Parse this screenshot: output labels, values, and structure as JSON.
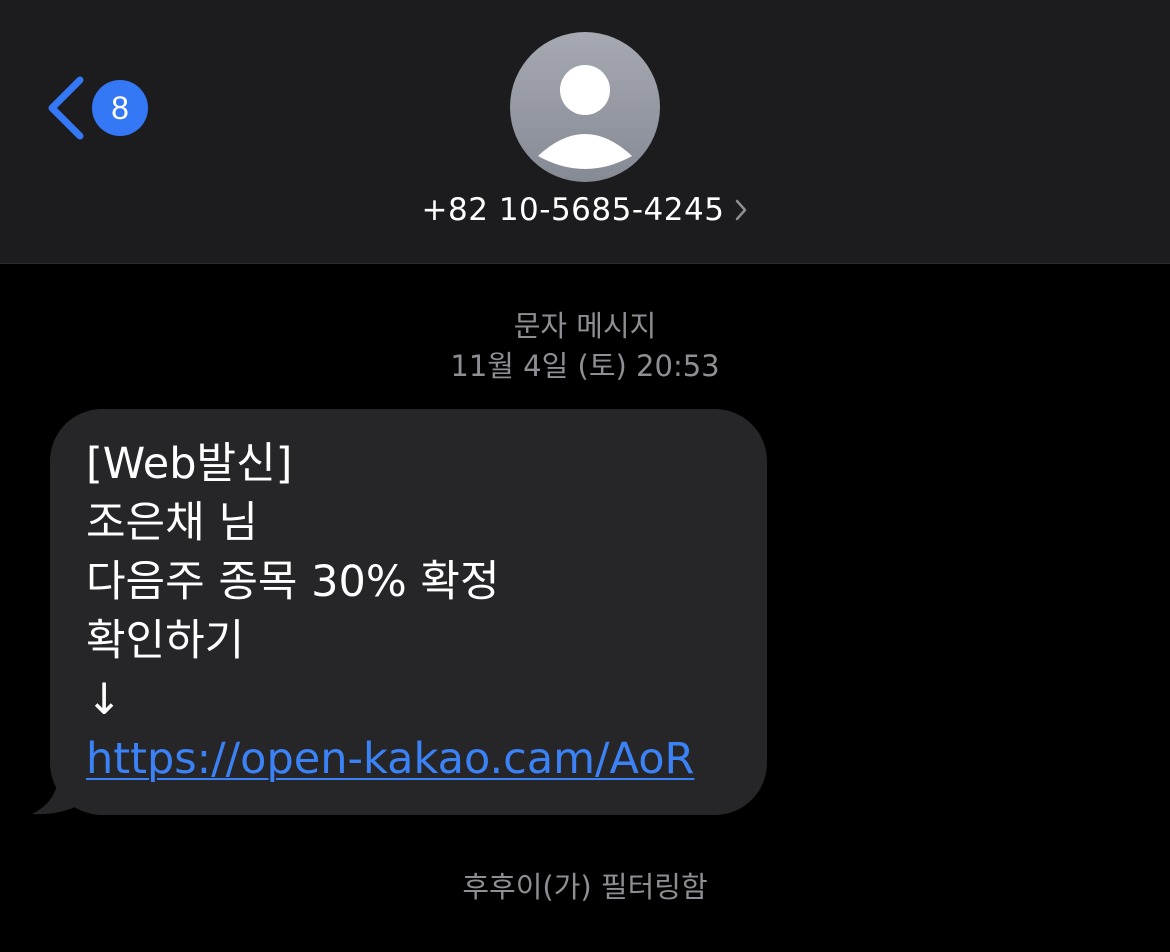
{
  "header": {
    "back_badge_count": "8",
    "contact_number": "+82 10-5685-4245",
    "icons": {
      "back": "chevron-left-icon",
      "avatar": "person-icon",
      "details": "chevron-right-icon"
    }
  },
  "conversation": {
    "message_type": "문자 메시지",
    "timestamp": "11월 4일 (토) 20:53",
    "message": {
      "lines": [
        "[Web발신]",
        "조은채 님",
        "다음주 종목 30% 확정",
        "확인하기",
        "↓"
      ],
      "link": "https://open-kakao.cam/AoR"
    },
    "filter_note": "후후이(가) 필터링함"
  },
  "colors": {
    "background": "#000000",
    "header_background": "#1c1c1e",
    "bubble": "#262629",
    "accent": "#3478f6",
    "secondary_text": "#8e8e93"
  }
}
